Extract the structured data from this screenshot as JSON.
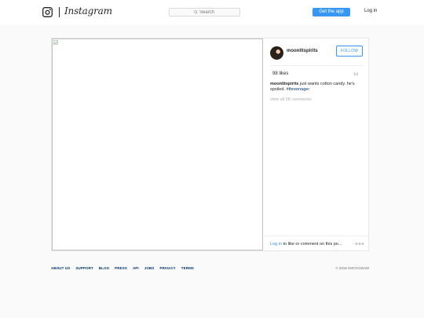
{
  "header": {
    "logo_text": "Instagram",
    "search_placeholder": "Search",
    "get_app_label": "Get the app",
    "login_label": "Log in"
  },
  "post": {
    "username": "moonlitspirits",
    "follow_label": "FOLLOW",
    "likes": "98 likes",
    "time": "1d",
    "caption_user": "moonlitspirits",
    "caption_text": " just wants cotton candy. he's spoiled. ",
    "caption_tag": "#threenager",
    "view_all": "view all 38 comments",
    "login_link": "Log in",
    "login_rest": " to like or comment on this po..."
  },
  "footer": {
    "links": [
      "ABOUT US",
      "SUPPORT",
      "BLOG",
      "PRESS",
      "API",
      "JOBS",
      "PRIVACY",
      "TERMS"
    ],
    "copyright": "© 2016 INSTAGRAM"
  },
  "colors": {
    "accent": "#3897f0",
    "footer_link": "#003569",
    "background": "#fafafa"
  },
  "icons": {
    "logo": "instagram-camera-icon",
    "search": "search-icon",
    "broken_image": "broken-image-icon",
    "more": "more-options-icon"
  }
}
